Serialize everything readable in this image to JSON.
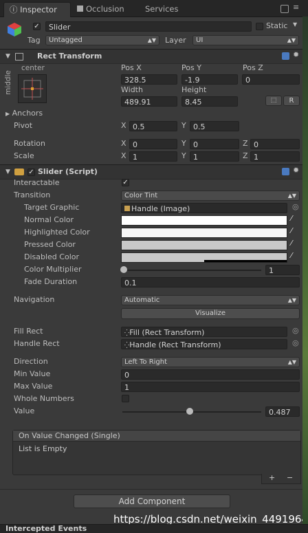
{
  "tabs": {
    "inspector": "Inspector",
    "occlusion": "Occlusion",
    "services": "Services"
  },
  "object": {
    "name": "Slider",
    "static_label": "Static",
    "tag_label": "Tag",
    "tag_value": "Untagged",
    "layer_label": "Layer",
    "layer_value": "UI"
  },
  "rect_transform": {
    "title": "Rect Transform",
    "anchor_h": "center",
    "anchor_v": "middle",
    "pos_x_label": "Pos X",
    "pos_y_label": "Pos Y",
    "pos_z_label": "Pos Z",
    "pos_x": "328.5",
    "pos_y": "-1.9",
    "pos_z": "0",
    "width_label": "Width",
    "height_label": "Height",
    "width": "489.91",
    "height": "8.45",
    "anchors_label": "Anchors",
    "pivot_label": "Pivot",
    "pivot_x": "0.5",
    "pivot_y": "0.5",
    "rotation_label": "Rotation",
    "rot_x": "0",
    "rot_y": "0",
    "rot_z": "0",
    "scale_label": "Scale",
    "scale_x": "1",
    "scale_y": "1",
    "scale_z": "1",
    "raw_btn": "R",
    "axis_x": "X",
    "axis_y": "Y",
    "axis_z": "Z"
  },
  "slider": {
    "title": "Slider (Script)",
    "interactable_label": "Interactable",
    "transition_label": "Transition",
    "transition_value": "Color Tint",
    "target_graphic_label": "Target Graphic",
    "target_graphic_value": "Handle (Image)",
    "normal_color_label": "Normal Color",
    "highlighted_color_label": "Highlighted Color",
    "pressed_color_label": "Pressed Color",
    "disabled_color_label": "Disabled Color",
    "color_multiplier_label": "Color Multiplier",
    "color_multiplier_value": "1",
    "fade_duration_label": "Fade Duration",
    "fade_duration_value": "0.1",
    "navigation_label": "Navigation",
    "navigation_value": "Automatic",
    "visualize_label": "Visualize",
    "fill_rect_label": "Fill Rect",
    "fill_rect_value": "Fill (Rect Transform)",
    "handle_rect_label": "Handle Rect",
    "handle_rect_value": "Handle (Rect Transform)",
    "direction_label": "Direction",
    "direction_value": "Left To Right",
    "min_value_label": "Min Value",
    "min_value": "0",
    "max_value_label": "Max Value",
    "max_value": "1",
    "whole_numbers_label": "Whole Numbers",
    "value_label": "Value",
    "value": "0.487",
    "value_fraction": 0.487,
    "color_multiplier_fraction": 0.0,
    "colors": {
      "normal": "#ffffff",
      "highlighted": "#f5f5f5",
      "pressed": "#c8c8c8",
      "disabled": "#c8c8c8"
    }
  },
  "event": {
    "title": "On Value Changed (Single)",
    "empty": "List is Empty",
    "add": "+",
    "remove": "−"
  },
  "add_component": "Add Component",
  "watermark": "https://blog.csdn.net/weixin_44919646",
  "bottom_title": "Intercepted Events",
  "icons": [
    "cube-icon",
    "gear-icon",
    "help-icon",
    "eye-icon",
    "pencil-icon"
  ]
}
